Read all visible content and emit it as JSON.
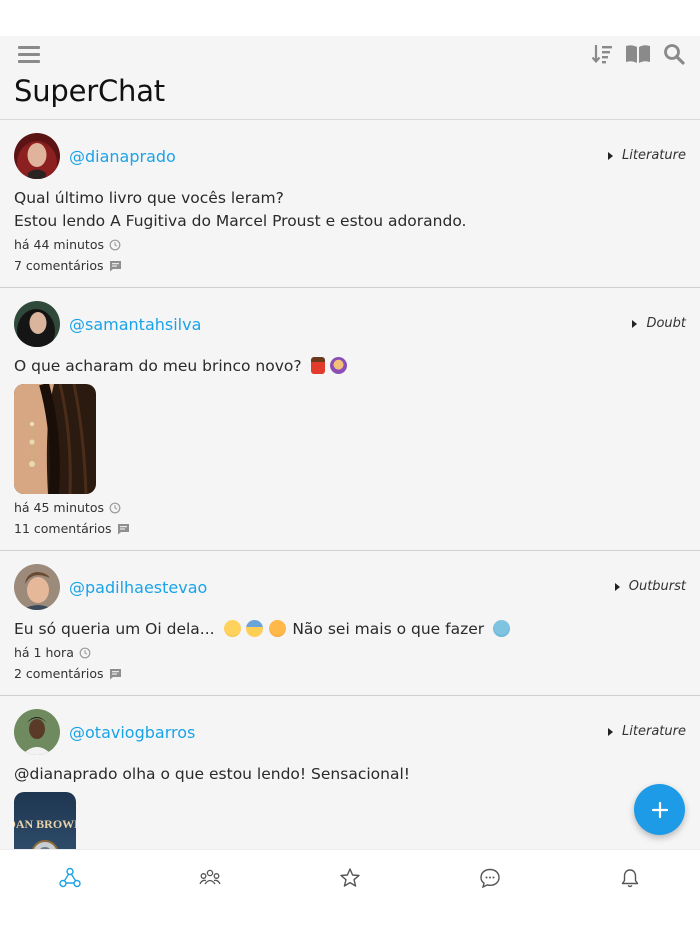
{
  "app": {
    "title": "SuperChat"
  },
  "colors": {
    "accent": "#1aa3e8",
    "fab": "#1e9be6",
    "icon_gray": "#8a8a8a"
  },
  "toolbar": {
    "icons": [
      "menu-icon",
      "sort-icon",
      "book-icon",
      "search-icon"
    ]
  },
  "posts": [
    {
      "username": "@dianaprado",
      "category": "Literature",
      "lines": [
        "Qual último livro que vocês leram?",
        "Estou lendo A Fugitiva do Marcel Proust e estou adorando."
      ],
      "time": "há 44 minutos",
      "comments": "7 comentários"
    },
    {
      "username": "@samantahsilva",
      "category": "Doubt",
      "text": "O que acharam do meu brinco novo?",
      "emojis": [
        "dancer-emoji",
        "woman-emoji"
      ],
      "has_image": true,
      "time": "há 45 minutos",
      "comments": "11 comentários"
    },
    {
      "username": "@padilhaestevao",
      "category": "Outburst",
      "text_before": "Eu só queria um Oi dela...",
      "text_after": "Não sei mais o que fazer",
      "emojis": [
        "crying-face-emoji",
        "downcast-face-emoji",
        "angry-face-emoji",
        "loudly-crying-face-emoji"
      ],
      "time": "há 1 hora",
      "comments": "2 comentários"
    },
    {
      "username": "@otaviogbarros",
      "category": "Literature",
      "text": "@dianaprado olha o que estou lendo! Sensacional!",
      "has_image": true,
      "book_author": "DAN BROWN"
    }
  ],
  "bottom_nav": [
    "feed-icon",
    "community-icon",
    "star-icon",
    "chat-icon",
    "bell-icon"
  ],
  "fab": {
    "icon": "plus-icon"
  }
}
